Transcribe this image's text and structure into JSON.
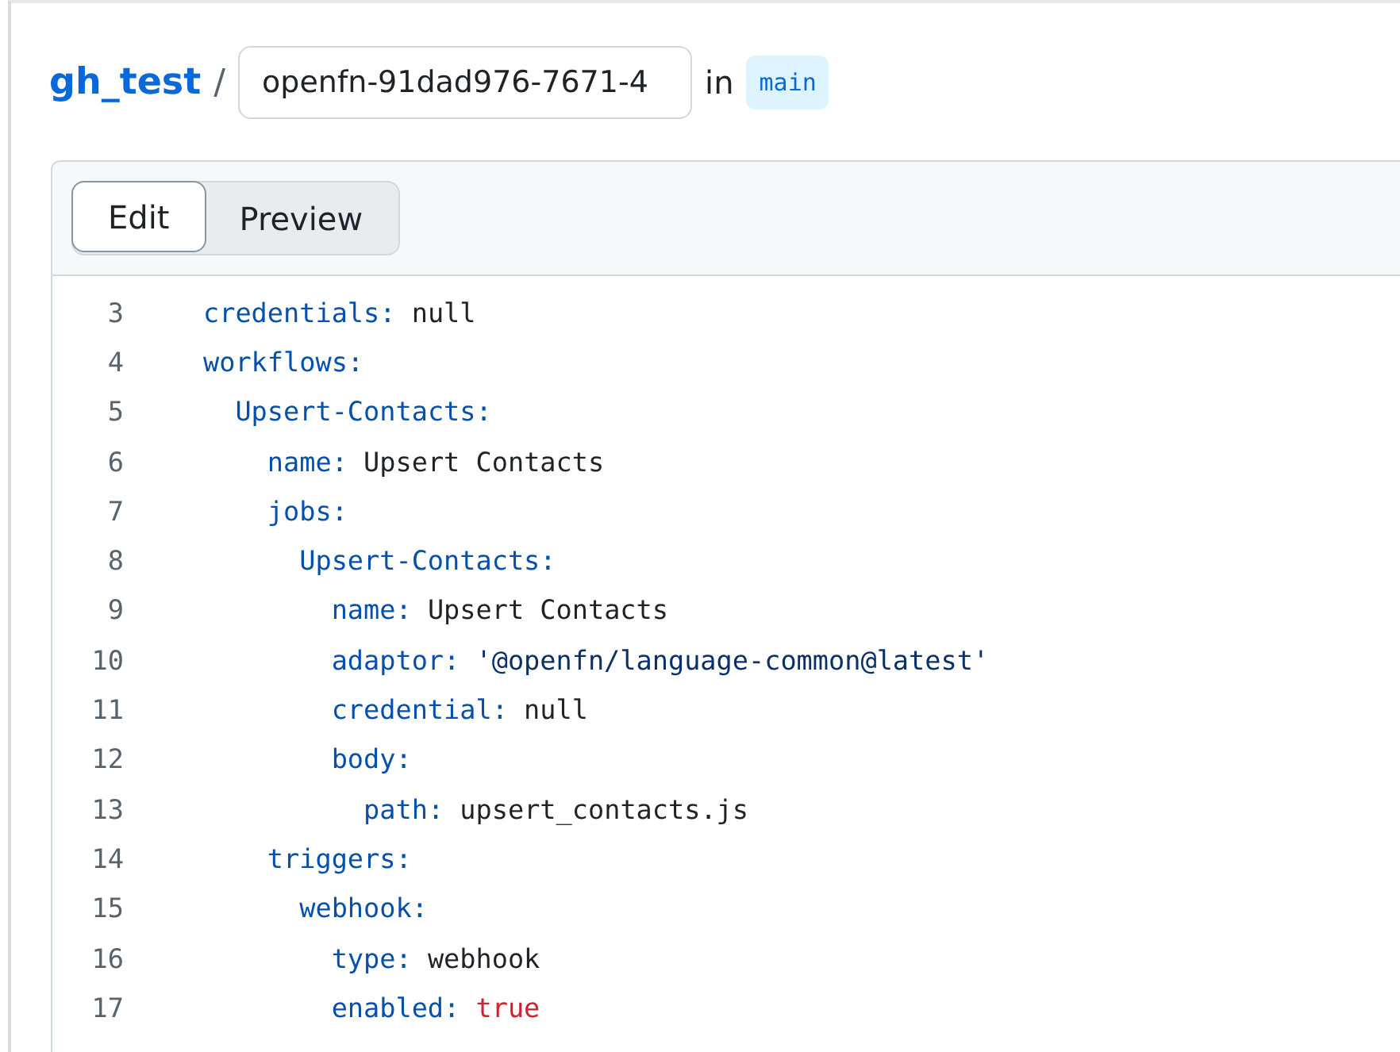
{
  "breadcrumb": {
    "owner": "gh_test",
    "separator": "/",
    "filename": "openfn-91dad976-7671-4",
    "branch_prefix": "in",
    "branch": "main"
  },
  "tabs": [
    {
      "label": "Edit",
      "selected": true
    },
    {
      "label": "Preview",
      "selected": false
    }
  ],
  "code_lines": [
    {
      "number": "3",
      "key": "credentials:",
      "value": "null",
      "kind": "plain"
    },
    {
      "number": "4",
      "key": "workflows:",
      "children": [
        {
          "number": "5",
          "key": "Upsert-Contacts:",
          "children": [
            {
              "number": "6",
              "key": "name:",
              "value": "Upsert Contacts",
              "kind": "plain"
            },
            {
              "number": "7",
              "key": "jobs:",
              "children": [
                {
                  "number": "8",
                  "key": "Upsert-Contacts:",
                  "children": [
                    {
                      "number": "9",
                      "key": "name:",
                      "value": "Upsert Contacts",
                      "kind": "plain"
                    },
                    {
                      "number": "10",
                      "key": "adaptor:",
                      "value": "'@openfn/language-common@latest'",
                      "kind": "string"
                    },
                    {
                      "number": "11",
                      "key": "credential:",
                      "value": "null",
                      "kind": "plain"
                    },
                    {
                      "number": "12",
                      "key": "body:",
                      "children": [
                        {
                          "number": "13",
                          "key": "path:",
                          "value": "upsert_contacts.js",
                          "kind": "plain"
                        }
                      ]
                    }
                  ]
                }
              ]
            },
            {
              "number": "14",
              "key": "triggers:",
              "children": [
                {
                  "number": "15",
                  "key": "webhook:",
                  "children": [
                    {
                      "number": "16",
                      "key": "type:",
                      "value": "webhook",
                      "kind": "plain"
                    },
                    {
                      "number": "17",
                      "key": "enabled:",
                      "value": "true",
                      "kind": "boolean"
                    }
                  ]
                }
              ]
            }
          ]
        }
      ]
    }
  ]
}
